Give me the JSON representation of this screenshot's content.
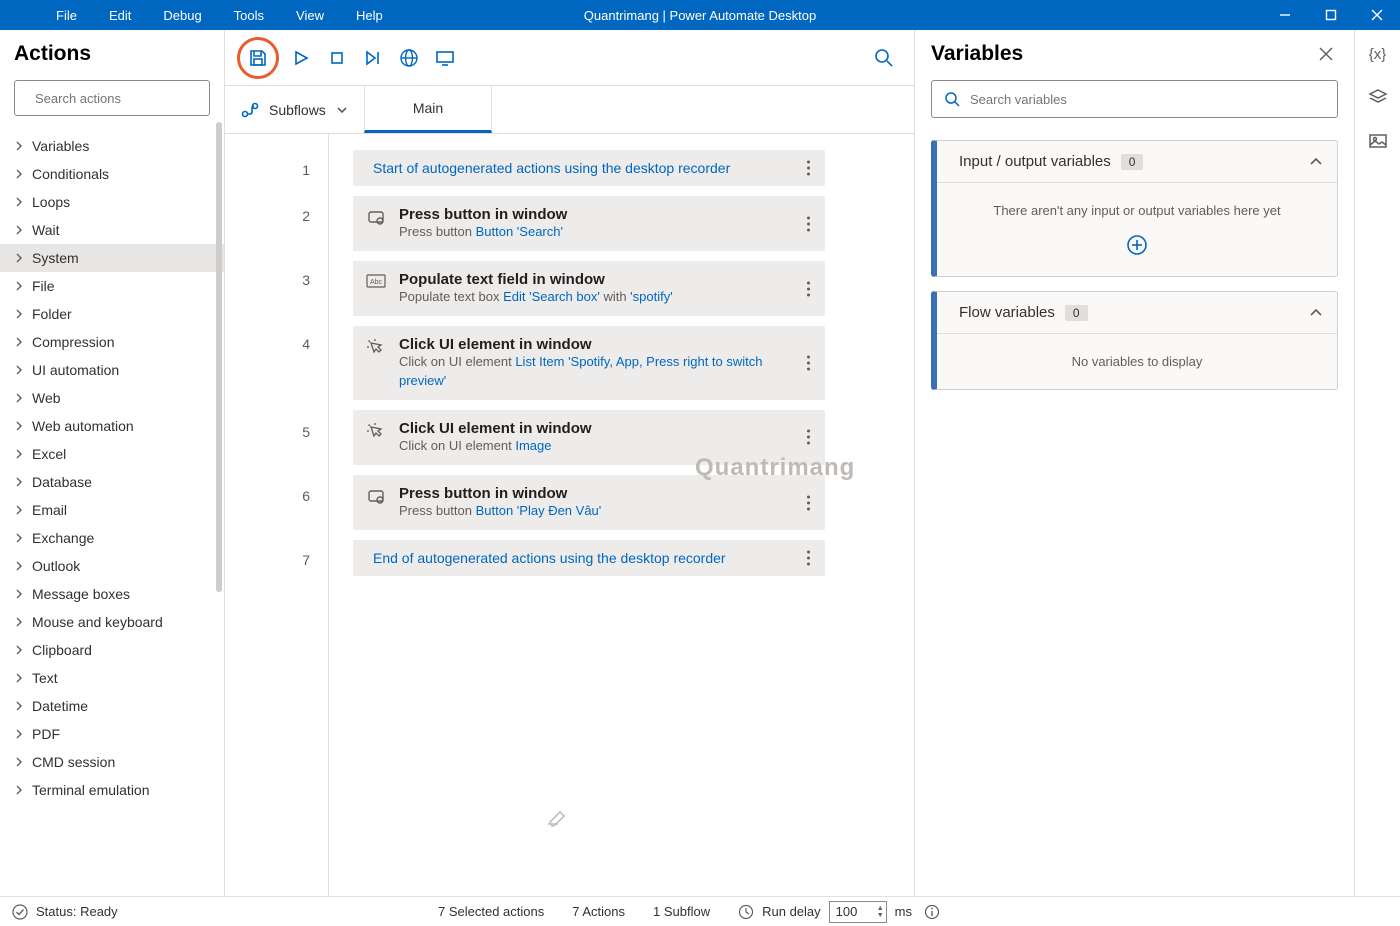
{
  "titlebar": {
    "menus": [
      "File",
      "Edit",
      "Debug",
      "Tools",
      "View",
      "Help"
    ],
    "app_title": "Quantrimang | Power Automate Desktop"
  },
  "actions_panel": {
    "header": "Actions",
    "search_placeholder": "Search actions",
    "selected": "System",
    "categories": [
      "Variables",
      "Conditionals",
      "Loops",
      "Wait",
      "System",
      "File",
      "Folder",
      "Compression",
      "UI automation",
      "Web",
      "Web automation",
      "Excel",
      "Database",
      "Email",
      "Exchange",
      "Outlook",
      "Message boxes",
      "Mouse and keyboard",
      "Clipboard",
      "Text",
      "Datetime",
      "PDF",
      "CMD session",
      "Terminal emulation"
    ]
  },
  "editor": {
    "subflows_label": "Subflows",
    "tab_main": "Main",
    "watermark": "Quantrimang",
    "steps": [
      {
        "n": "1",
        "kind": "note",
        "note": "Start of autogenerated actions using the desktop recorder"
      },
      {
        "n": "2",
        "kind": "press",
        "title": "Press button in window",
        "desc_a": "Press button ",
        "desc_l1": "Button 'Search'"
      },
      {
        "n": "3",
        "kind": "populate",
        "title": "Populate text field in window",
        "desc_a": "Populate text box ",
        "desc_l1": "Edit 'Search box'",
        "desc_b": " with ",
        "desc_l2": "'spotify'"
      },
      {
        "n": "4",
        "kind": "click",
        "title": "Click UI element in window",
        "desc_a": "Click on UI element ",
        "desc_l1": "List Item 'Spotify, App, Press right to switch preview'"
      },
      {
        "n": "5",
        "kind": "click",
        "title": "Click UI element in window",
        "desc_a": "Click on UI element ",
        "desc_l1": "Image"
      },
      {
        "n": "6",
        "kind": "press",
        "title": "Press button in window",
        "desc_a": "Press button ",
        "desc_l1": "Button 'Play Đen Vâu'"
      },
      {
        "n": "7",
        "kind": "note",
        "note": "End of autogenerated actions using the desktop recorder"
      }
    ]
  },
  "variables_panel": {
    "header": "Variables",
    "search_placeholder": "Search variables",
    "io_vars_title": "Input / output variables",
    "io_vars_count": "0",
    "io_vars_empty": "There aren't any input or output variables here yet",
    "flow_vars_title": "Flow variables",
    "flow_vars_count": "0",
    "flow_vars_empty": "No variables to display"
  },
  "status": {
    "ready": "Status: Ready",
    "selected": "7 Selected actions",
    "actions": "7 Actions",
    "subflows": "1 Subflow",
    "run_delay_label": "Run delay",
    "run_delay_value": "100",
    "ms": "ms"
  }
}
